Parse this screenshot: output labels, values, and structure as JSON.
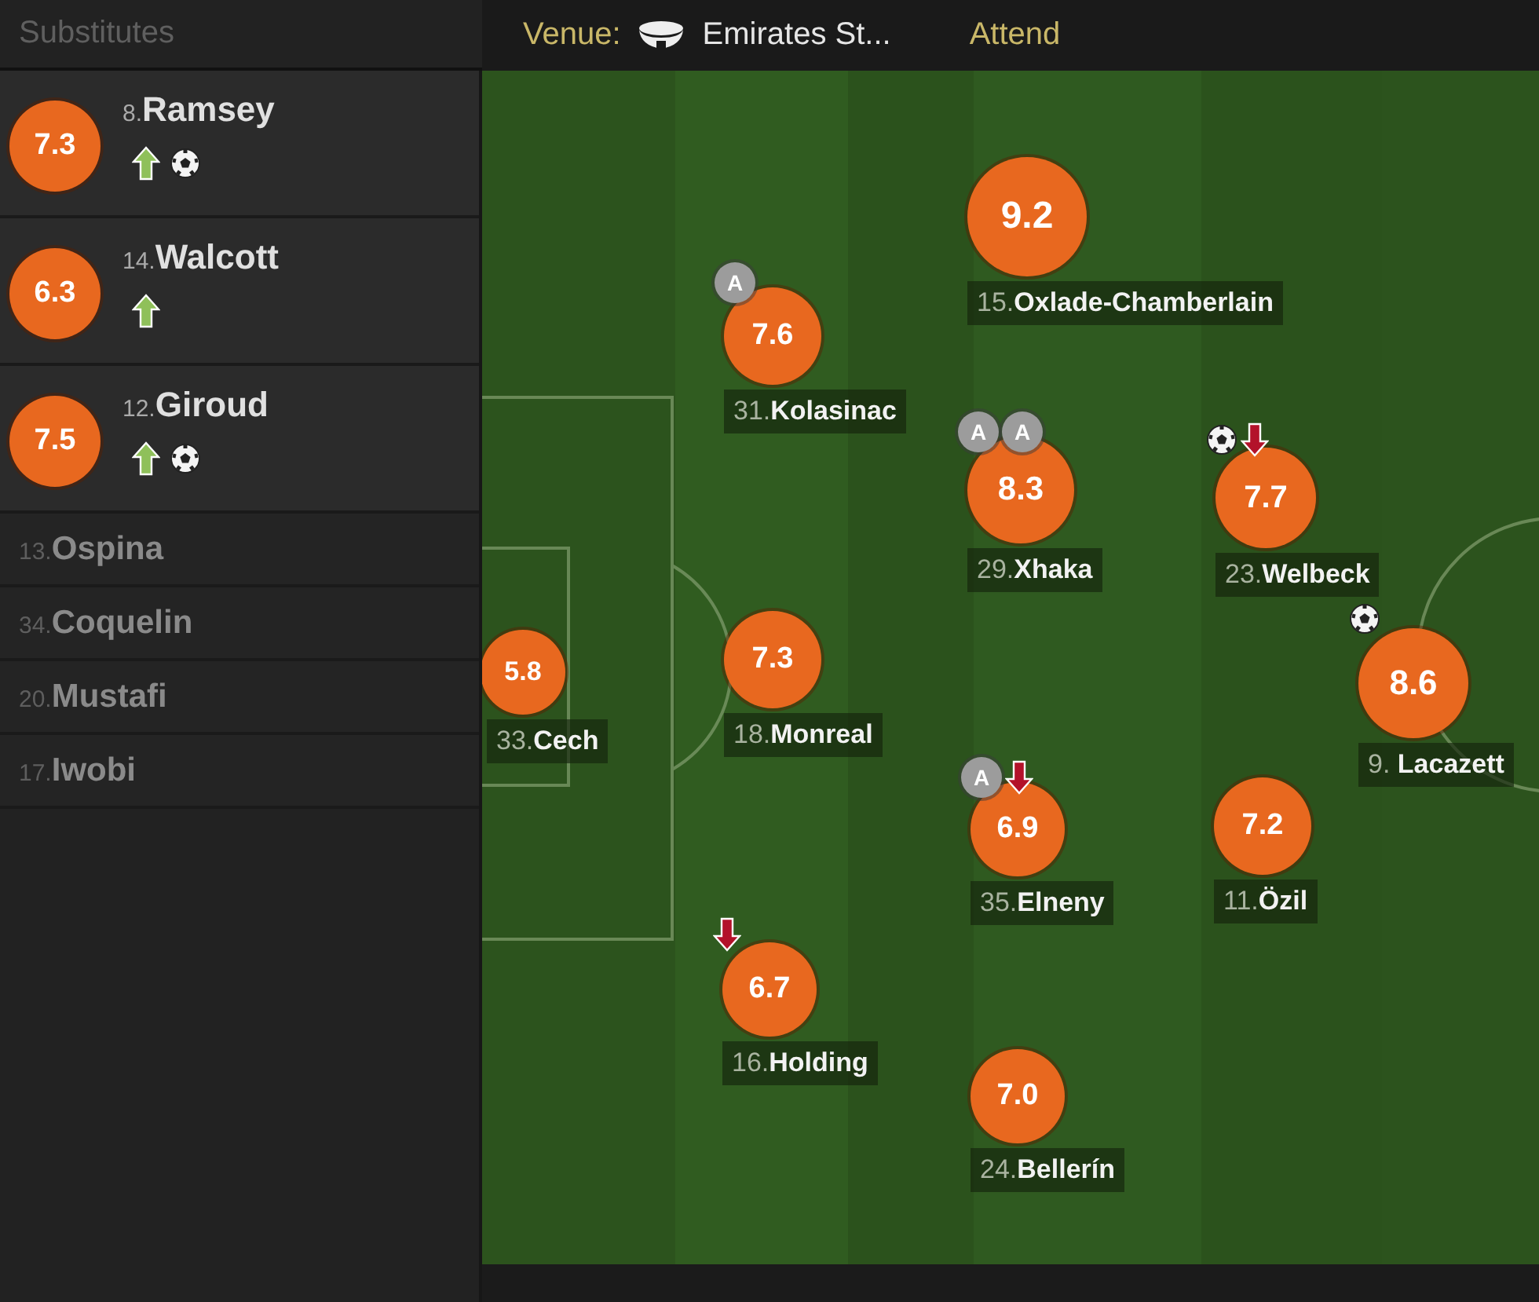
{
  "sidebar": {
    "title": "Substitutes",
    "substitutes": [
      {
        "number": "8.",
        "name": "Ramsey",
        "rating": "7.3",
        "played": true,
        "events": [
          {
            "kind": "sub_on"
          },
          {
            "kind": "goal"
          }
        ]
      },
      {
        "number": "14.",
        "name": "Walcott",
        "rating": "6.3",
        "played": true,
        "events": [
          {
            "kind": "sub_on"
          }
        ]
      },
      {
        "number": "12.",
        "name": "Giroud",
        "rating": "7.5",
        "played": true,
        "events": [
          {
            "kind": "sub_on"
          },
          {
            "kind": "goal"
          }
        ]
      },
      {
        "number": "13.",
        "name": "Ospina",
        "played": false
      },
      {
        "number": "34.",
        "name": "Coquelin",
        "played": false
      },
      {
        "number": "20.",
        "name": "Mustafi",
        "played": false
      },
      {
        "number": "17.",
        "name": "Iwobi",
        "played": false
      }
    ]
  },
  "match_info": {
    "venue_label": "Venue:",
    "venue": "Emirates St...",
    "attendance_label": "Attend"
  },
  "pitch": {
    "players": [
      {
        "number": "33.",
        "name": "Cech",
        "rating": "5.8"
      },
      {
        "number": "31.",
        "name": "Kolasinac",
        "rating": "7.6",
        "events": [
          {
            "kind": "assist",
            "label": "A"
          }
        ]
      },
      {
        "number": "18.",
        "name": "Monreal",
        "rating": "7.3"
      },
      {
        "number": "16.",
        "name": "Holding",
        "rating": "6.7",
        "events": [
          {
            "kind": "sub_off"
          }
        ]
      },
      {
        "number": "15.",
        "name": "Oxlade-Chamberlain",
        "rating": "9.2"
      },
      {
        "number": "29.",
        "name": "Xhaka",
        "rating": "8.3",
        "events": [
          {
            "kind": "assist",
            "label": "A"
          },
          {
            "kind": "assist",
            "label": "A"
          }
        ]
      },
      {
        "number": "35.",
        "name": "Elneny",
        "rating": "6.9",
        "events": [
          {
            "kind": "assist",
            "label": "A"
          },
          {
            "kind": "sub_off"
          }
        ]
      },
      {
        "number": "24.",
        "name": "Bellerín",
        "rating": "7.0"
      },
      {
        "number": "23.",
        "name": "Welbeck",
        "rating": "7.7",
        "events": [
          {
            "kind": "goal"
          },
          {
            "kind": "sub_off"
          }
        ]
      },
      {
        "number": "11.",
        "name": "Özil",
        "rating": "7.2"
      },
      {
        "number": "9. ",
        "name": "Lacazett",
        "rating": "8.6",
        "events": [
          {
            "kind": "goal"
          }
        ]
      }
    ]
  }
}
